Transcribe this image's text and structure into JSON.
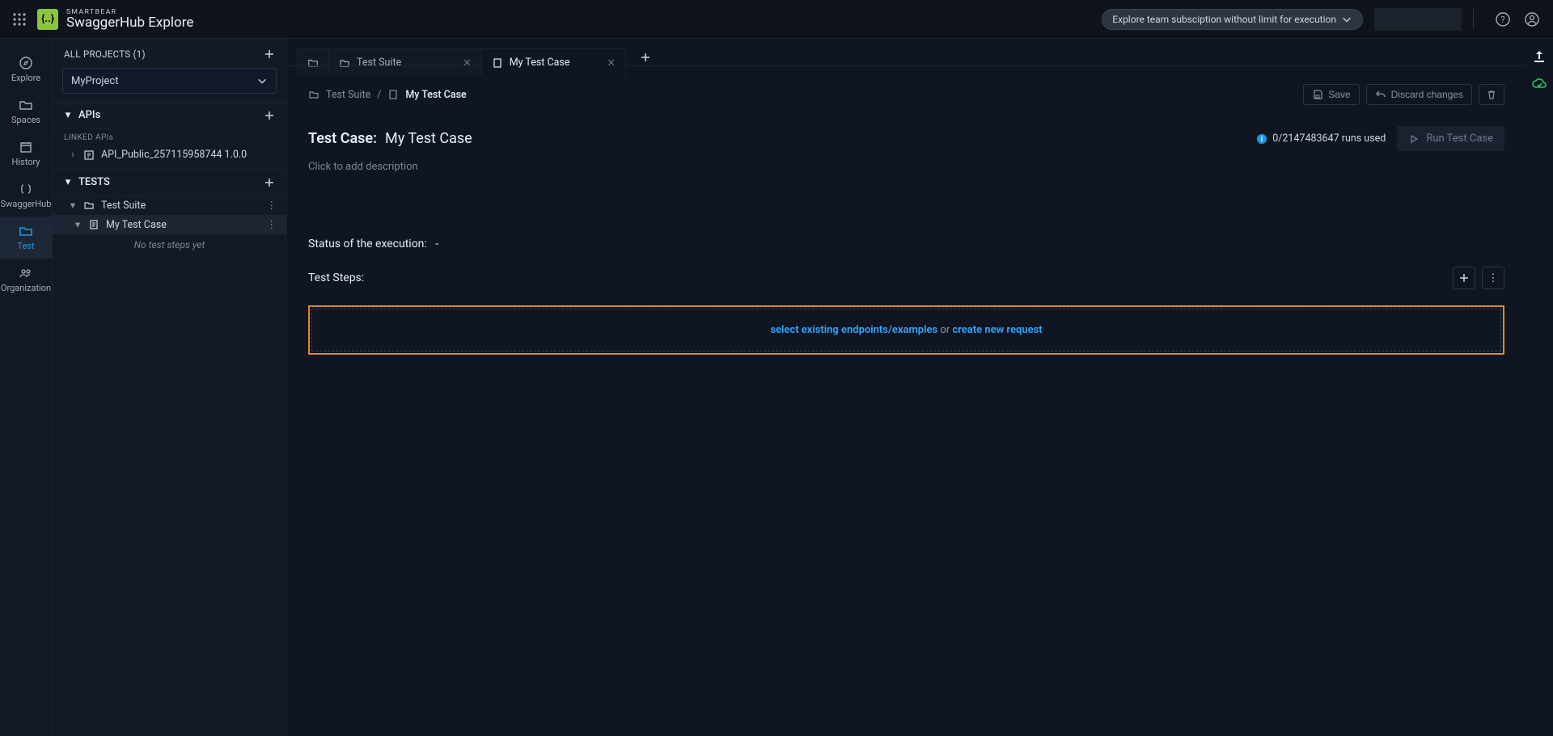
{
  "topbar": {
    "brand_small": "SMARTBEAR",
    "brand_big": "SwaggerHub Explore",
    "subscription_label": "Explore team subsciption without limit for execution"
  },
  "rail": {
    "explore": "Explore",
    "spaces": "Spaces",
    "history": "History",
    "swaggerhub": "SwaggerHub",
    "test": "Test",
    "organization": "Organization"
  },
  "side": {
    "projects_header": "ALL PROJECTS (1)",
    "project_selected": "MyProject",
    "apis_label": "APIs",
    "linked_apis_label": "LINKED APIs",
    "linked_api_name": "API_Public_257115958744 1.0.0",
    "tests_label": "TESTS",
    "test_suite": "Test Suite",
    "test_case": "My Test Case",
    "empty_steps": "No test steps yet"
  },
  "tabs": {
    "tab1": "Test Suite",
    "tab2": "My Test Case"
  },
  "breadcrumb": {
    "parent": "Test Suite",
    "current": "My Test Case"
  },
  "actions": {
    "save": "Save",
    "discard": "Discard changes"
  },
  "title": {
    "prefix": "Test Case:",
    "name": "My Test Case"
  },
  "runs": {
    "text": "0/2147483647 runs used"
  },
  "run_button": "Run Test Case",
  "description_placeholder": "Click to add description",
  "status_label": "Status of the execution:",
  "status_value": "-",
  "steps_label": "Test Steps:",
  "drop": {
    "link1": "select existing endpoints/examples",
    "middle": " or ",
    "link2": "create new request"
  }
}
